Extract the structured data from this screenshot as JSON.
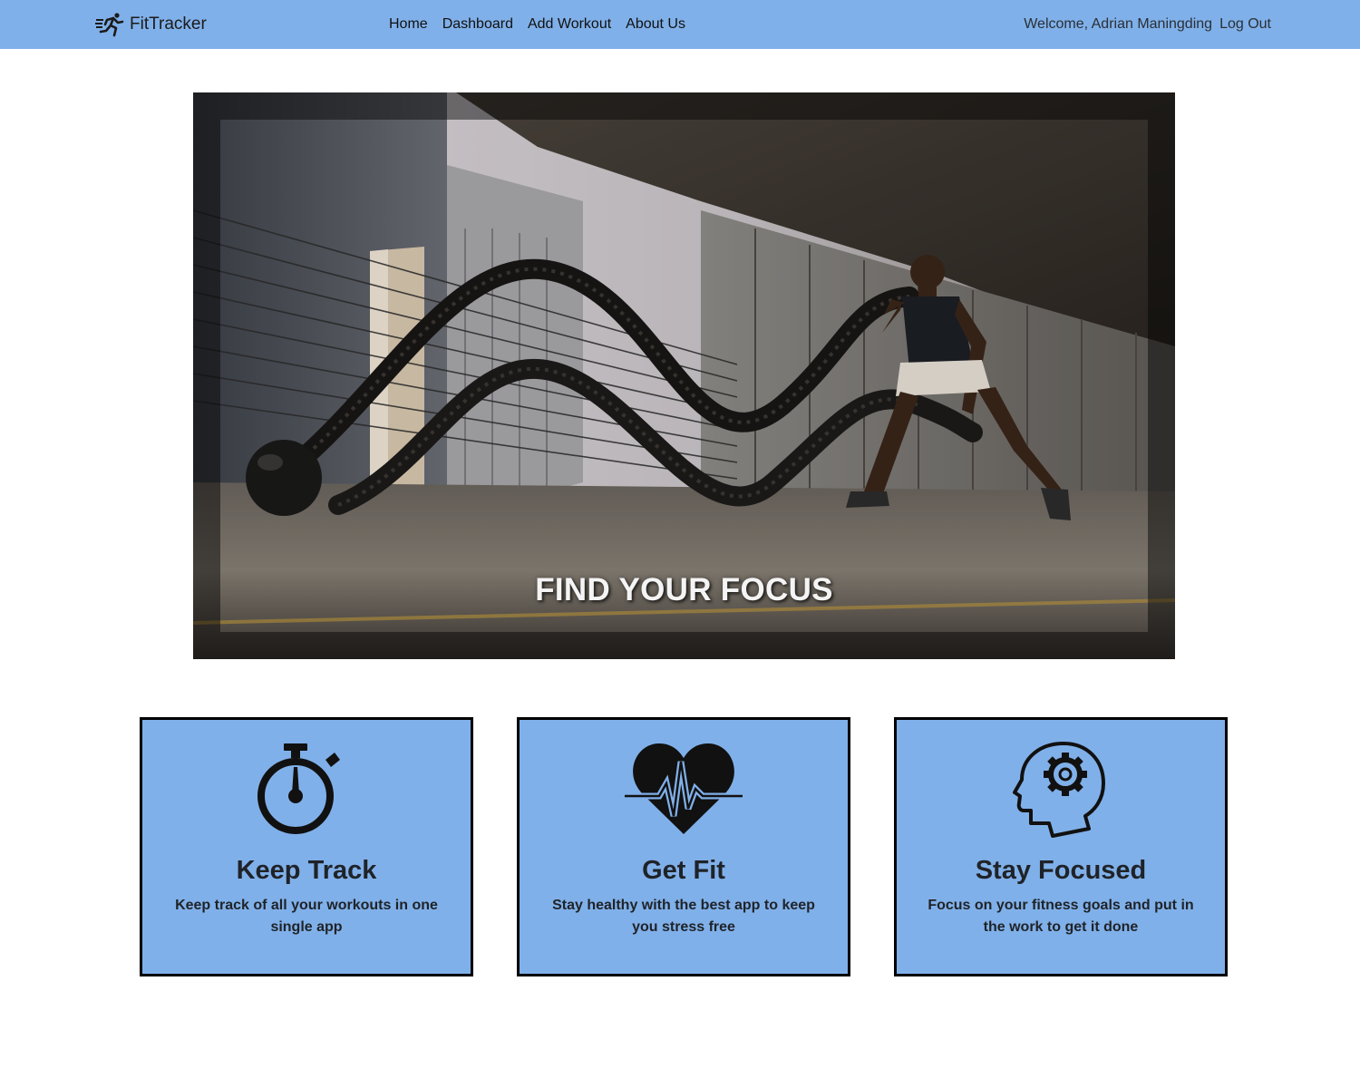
{
  "navbar": {
    "brand": "FitTracker",
    "links": [
      "Home",
      "Dashboard",
      "Add Workout",
      "About Us"
    ],
    "welcome": "Welcome, Adrian Maningding",
    "logout": "Log Out",
    "background_color": "#80b0e9"
  },
  "hero": {
    "caption": "FIND YOUR FOCUS",
    "image_description": "battle-ropes-workout-photo"
  },
  "features": [
    {
      "icon": "stopwatch-icon",
      "title": "Keep Track",
      "text": "Keep track of all your workouts in one single app"
    },
    {
      "icon": "heartbeat-icon",
      "title": "Get Fit",
      "text": "Stay healthy with the best app to keep you stress free"
    },
    {
      "icon": "head-gear-icon",
      "title": "Stay Focused",
      "text": "Focus on your fitness goals and put in the work to get it done"
    }
  ],
  "colors": {
    "card_background": "#80b0e9",
    "card_border": "#000000",
    "text": "#1f2328"
  }
}
